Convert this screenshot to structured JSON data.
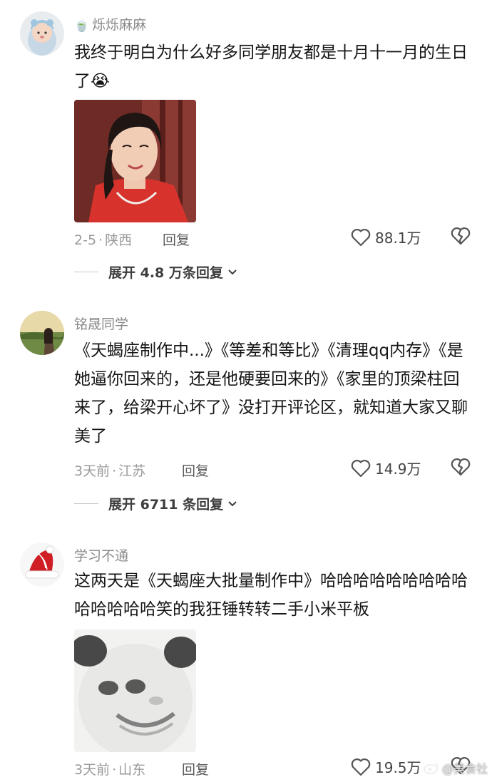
{
  "comments": [
    {
      "username_badge": "🍵",
      "username": "烁烁麻麻",
      "text": "我终于明白为什么好多同学朋友都是十月十一月的生日了😭",
      "date": "2-5",
      "location": "陕西",
      "reply_label": "回复",
      "likes": "88.1万",
      "expand_label": "展开 4.8 万条回复",
      "has_image": true
    },
    {
      "username": "铭晟同学",
      "text": "《天蝎座制作中...》《等差和等比》《清理qq内存》《是她逼你回来的，还是他硬要回来的》《家里的顶梁柱回来了，给梁开心坏了》没打开评论区，就知道大家又聊美了",
      "date": "3天前",
      "location": "江苏",
      "reply_label": "回复",
      "likes": "14.9万",
      "expand_label": "展开 6711 条回复"
    },
    {
      "username": "学习不通",
      "text": "这两天是《天蝎座大批量制作中》哈哈哈哈哈哈哈哈哈哈哈哈哈哈笑的我狂锤转转二手小米平板",
      "date": "3天前",
      "location": "山东",
      "reply_label": "回复",
      "likes": "19.5万",
      "has_image": true
    }
  ],
  "meta_separator": "·",
  "watermark": "@美食社",
  "colors": {
    "text": "#161616",
    "meta": "#9a9a9a",
    "accent_dark": "#3d3d3d"
  }
}
